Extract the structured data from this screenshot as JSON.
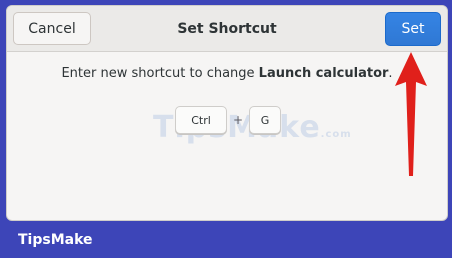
{
  "header": {
    "cancel_label": "Cancel",
    "title": "Set Shortcut",
    "set_label": "Set"
  },
  "prompt": {
    "prefix": "Enter new shortcut to change ",
    "action": "Launch calculator",
    "suffix": "."
  },
  "shortcut": {
    "keys": [
      "Ctrl",
      "G"
    ],
    "separator": "+"
  },
  "watermark": "TipsMake",
  "watermark_suffix": ".com",
  "footer_brand": "TipsMake",
  "colors": {
    "accent": "#3584e4",
    "annotation_arrow": "#e0201b",
    "frame": "#3d45b8"
  }
}
